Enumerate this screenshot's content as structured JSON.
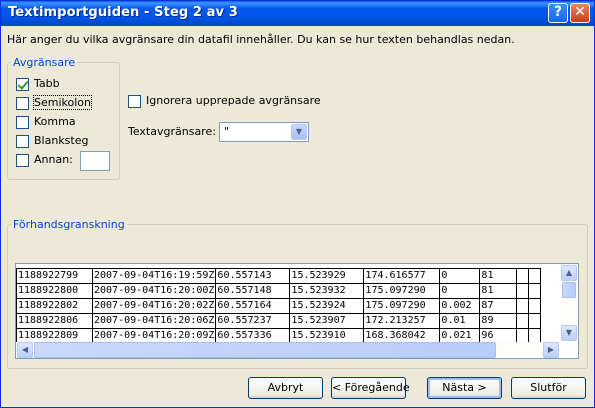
{
  "window": {
    "title": "Textimportguiden - Steg 2 av 3"
  },
  "intro": "Här anger du vilka avgränsare din datafil innehåller. Du kan se hur texten behandlas nedan.",
  "delimiters": {
    "legend": "Avgränsare",
    "tab": "Tabb",
    "semicolon": "Semikolon",
    "comma": "Komma",
    "space": "Blanksteg",
    "other": "Annan:"
  },
  "options": {
    "ignore_consecutive": "Ignorera upprepade avgränsare",
    "qualifier_label": "Textavgränsare:",
    "qualifier_value": "\""
  },
  "preview": {
    "legend": "Förhandsgranskning",
    "rows": [
      [
        "1188922799",
        "2007-09-04T16:19:59Z",
        "60.557143",
        "15.523929",
        "174.616577",
        "0",
        "81",
        "",
        ""
      ],
      [
        "1188922800",
        "2007-09-04T16:20:00Z",
        "60.557148",
        "15.523932",
        "175.097290",
        "0",
        "81",
        "",
        ""
      ],
      [
        "1188922802",
        "2007-09-04T16:20:02Z",
        "60.557164",
        "15.523924",
        "175.097290",
        "0.002",
        "87",
        "",
        ""
      ],
      [
        "1188922806",
        "2007-09-04T16:20:06Z",
        "60.557237",
        "15.523907",
        "172.213257",
        "0.01",
        "89",
        "",
        ""
      ],
      [
        "1188922809",
        "2007-09-04T16:20:09Z",
        "60.557336",
        "15.523910",
        "168.368042",
        "0.021",
        "96",
        "",
        ""
      ]
    ]
  },
  "buttons": {
    "cancel": "Avbryt",
    "back": "< Föregående",
    "next": "Nästa >",
    "finish": "Slutför"
  }
}
